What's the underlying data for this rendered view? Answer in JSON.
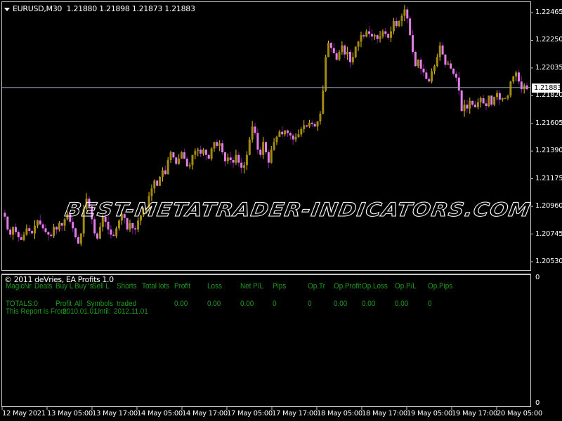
{
  "chart": {
    "symbol_title": "EURUSD,M30",
    "ohlc_header": "1.21880 1.21898 1.21873 1.21883",
    "current_price": "1.21883",
    "price_axis_labels": [
      "1.22465",
      "1.22250",
      "1.22035",
      "1.21820",
      "1.21605",
      "1.21390",
      "1.21175",
      "1.20960",
      "1.20745",
      "1.20530"
    ],
    "time_axis_labels": [
      "12 May 2021",
      "13 May 05:00",
      "13 May 17:00",
      "14 May 05:00",
      "14 May 17:00",
      "17 May 05:00",
      "17 May 17:00",
      "18 May 05:00",
      "18 May 17:00",
      "19 May 05:00",
      "19 May 17:00",
      "20 May 05:00"
    ],
    "watermark": "BEST-METATRADER-INDICATORS.COM",
    "colors": {
      "bull_body": "#a08a10",
      "bull_wick": "#e6c800",
      "bear_body": "#e07ee6",
      "bear_wick": "#8a1a9a",
      "bid_line": "#8a9aa8",
      "axis": "#c8c8c8"
    },
    "price_range": [
      1.2043,
      1.2252
    ],
    "closes": [
      1.2088,
      1.2078,
      1.2074,
      1.208,
      1.2076,
      1.2072,
      1.207,
      1.2074,
      1.2079,
      1.2077,
      1.2075,
      1.2081,
      1.2085,
      1.2082,
      1.2079,
      1.2076,
      1.2074,
      1.2073,
      1.208,
      1.2078,
      1.2083,
      1.2081,
      1.2086,
      1.209,
      1.2084,
      1.2079,
      1.2072,
      1.2067,
      1.2075,
      1.2094,
      1.2102,
      1.2096,
      1.2086,
      1.2075,
      1.2071,
      1.208,
      1.2088,
      1.2084,
      1.2078,
      1.2074,
      1.2073,
      1.2079,
      1.2085,
      1.209,
      1.2087,
      1.2078,
      1.2083,
      1.2079,
      1.2078,
      1.2085,
      1.2089,
      1.2091,
      1.2095,
      1.2104,
      1.211,
      1.2116,
      1.2112,
      1.2119,
      1.2124,
      1.2121,
      1.2132,
      1.2138,
      1.2134,
      1.2129,
      1.2133,
      1.2138,
      1.2133,
      1.2127,
      1.2128,
      1.2136,
      1.2139,
      1.214,
      1.2137,
      1.214,
      1.2136,
      1.2133,
      1.2141,
      1.2146,
      1.2143,
      1.2145,
      1.2138,
      1.2131,
      1.2134,
      1.2132,
      1.213,
      1.2136,
      1.213,
      1.2126,
      1.2128,
      1.2136,
      1.2148,
      1.2158,
      1.2153,
      1.214,
      1.2136,
      1.2146,
      1.2138,
      1.213,
      1.214,
      1.2146,
      1.215,
      1.2154,
      1.2152,
      1.2155,
      1.2153,
      1.2151,
      1.2148,
      1.215,
      1.2152,
      1.2156,
      1.2159,
      1.2158,
      1.2161,
      1.216,
      1.2158,
      1.2162,
      1.2168,
      1.2186,
      1.2212,
      1.2223,
      1.2219,
      1.2215,
      1.221,
      1.2216,
      1.2221,
      1.2214,
      1.2216,
      1.2208,
      1.2212,
      1.222,
      1.2224,
      1.2229,
      1.2228,
      1.2232,
      1.223,
      1.2228,
      1.2229,
      1.2226,
      1.2228,
      1.2232,
      1.223,
      1.2227,
      1.2232,
      1.224,
      1.2236,
      1.224,
      1.2244,
      1.2249,
      1.2242,
      1.2229,
      1.2216,
      1.2205,
      1.221,
      1.2203,
      1.22,
      1.2195,
      1.2193,
      1.2201,
      1.2205,
      1.2212,
      1.2221,
      1.2214,
      1.2206,
      1.2207,
      1.2203,
      1.2199,
      1.2196,
      1.2186,
      1.217,
      1.2175,
      1.2172,
      1.2178,
      1.2175,
      1.2173,
      1.2177,
      1.218,
      1.2176,
      1.2174,
      1.2182,
      1.2175,
      1.2181,
      1.2184,
      1.2179,
      1.218,
      1.218,
      1.2182,
      1.2193,
      1.2197,
      1.22,
      1.2193,
      1.2187,
      1.219,
      1.2187
    ]
  },
  "indicator": {
    "title": "© 2011 deVries, EA Profits 1.0",
    "headers": [
      "MagicNr",
      "Deals",
      "Buy L",
      "Buy 's",
      "Sell L",
      "Shorts",
      "Total lots",
      "Profit",
      "Loss",
      "Net P/L",
      "Pips",
      "Op.Tr",
      "Op.Profit",
      "Op.Loss",
      "Op.P/L",
      "Op.Pips"
    ],
    "totals_label": "TOTALS:0",
    "totals_note": [
      "Profit",
      "All",
      "Symbols",
      "traded"
    ],
    "totals_values": {
      "profit": "0.00",
      "loss": "0.00",
      "net_pl": "0.00",
      "pips": "0",
      "op_tr": "0",
      "op_profit": "0.00",
      "op_loss": "0.00",
      "op_pl": "0.00",
      "op_pips": "0"
    },
    "report_from_label": "This Report is From:",
    "report_from": "2010.01.01",
    "report_until_label": "Until:",
    "report_until": "2012.11.01",
    "scale_top": "0",
    "scale_bottom": "0"
  }
}
